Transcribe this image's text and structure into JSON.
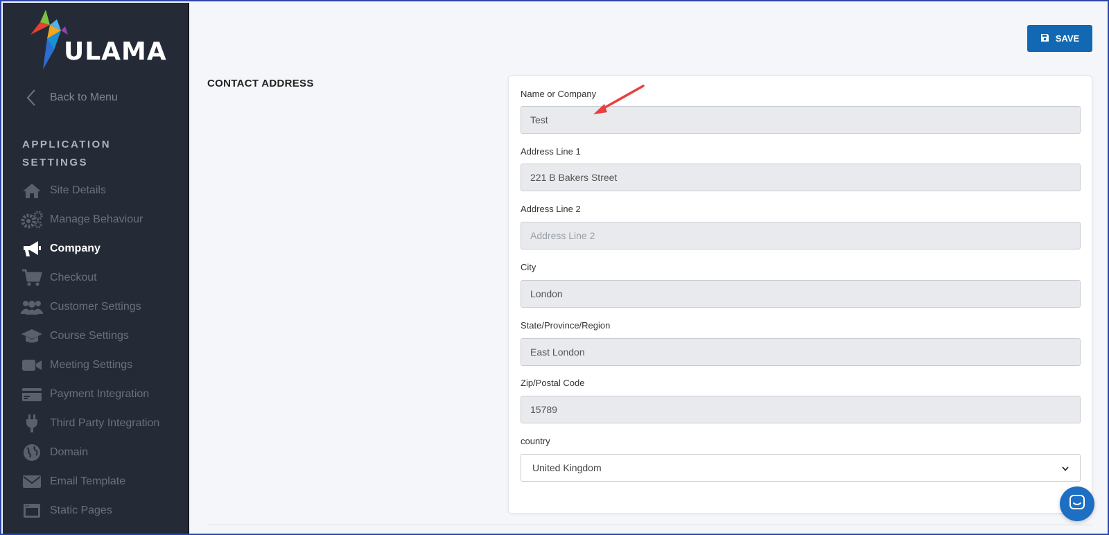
{
  "brand": {
    "name": "ULAMA"
  },
  "sidebar": {
    "back_label": "Back to Menu",
    "section_title": "APPLICATION SETTINGS",
    "items": [
      {
        "label": "Site Details",
        "icon": "home-icon"
      },
      {
        "label": "Manage Behaviour",
        "icon": "gears-icon"
      },
      {
        "label": "Company",
        "icon": "megaphone-icon",
        "active": true
      },
      {
        "label": "Checkout",
        "icon": "cart-icon"
      },
      {
        "label": "Customer Settings",
        "icon": "users-icon"
      },
      {
        "label": "Course Settings",
        "icon": "graduation-cap-icon"
      },
      {
        "label": "Meeting Settings",
        "icon": "video-icon"
      },
      {
        "label": "Payment Integration",
        "icon": "credit-card-icon"
      },
      {
        "label": "Third Party Integration",
        "icon": "plug-icon"
      },
      {
        "label": "Domain",
        "icon": "globe-icon"
      },
      {
        "label": "Email Template",
        "icon": "envelope-icon"
      },
      {
        "label": "Static Pages",
        "icon": "window-icon"
      }
    ]
  },
  "toolbar": {
    "save_label": "SAVE"
  },
  "section": {
    "heading": "CONTACT ADDRESS"
  },
  "form": {
    "name": {
      "label": "Name or Company",
      "value": "Test",
      "placeholder": "Name or Company"
    },
    "address1": {
      "label": "Address Line 1",
      "value": "221 B Bakers Street",
      "placeholder": "Address Line 1"
    },
    "address2": {
      "label": "Address Line 2",
      "value": "",
      "placeholder": "Address Line 2"
    },
    "city": {
      "label": "City",
      "value": "London",
      "placeholder": "City"
    },
    "state": {
      "label": "State/Province/Region",
      "value": "East London",
      "placeholder": "State/Province/Region"
    },
    "zip": {
      "label": "Zip/Postal Code",
      "value": "15789",
      "placeholder": "Zip/Postal Code"
    },
    "country": {
      "label": "country",
      "value": "United Kingdom"
    }
  },
  "colors": {
    "sidebar_bg": "#252b36",
    "accent": "#1268b3",
    "annotation_arrow": "#e84040"
  }
}
